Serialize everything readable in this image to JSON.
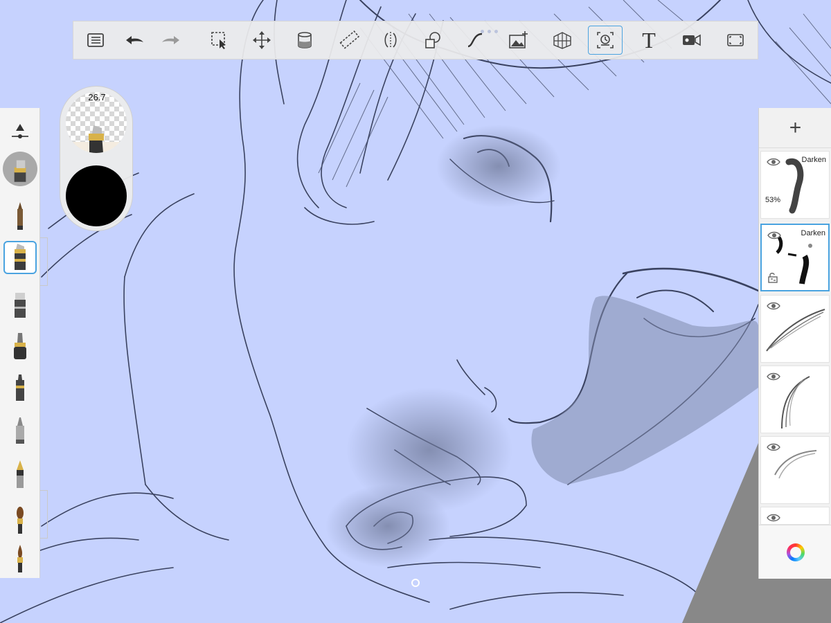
{
  "app": {
    "name": "Sketchbook canvas"
  },
  "toolbar": {
    "items": [
      {
        "icon": "menu-list-icon"
      },
      {
        "icon": "undo-icon"
      },
      {
        "icon": "redo-icon"
      },
      {
        "icon": "selection-icon"
      },
      {
        "icon": "transform-move-icon"
      },
      {
        "icon": "fill-bucket-icon"
      },
      {
        "icon": "ruler-icon"
      },
      {
        "icon": "symmetry-icon"
      },
      {
        "icon": "shapes-icon"
      },
      {
        "icon": "curve-icon"
      },
      {
        "icon": "add-image-icon"
      },
      {
        "icon": "perspective-grid-icon"
      },
      {
        "icon": "time-lapse-icon",
        "active": true
      },
      {
        "icon": "text-icon",
        "label": "T"
      },
      {
        "icon": "record-video-icon"
      },
      {
        "icon": "fullscreen-icon"
      }
    ]
  },
  "brush": {
    "size": "26.7",
    "color": "#000000"
  },
  "brush_palette": {
    "items": [
      "brush-properties-icon",
      "brush-library-icon",
      "pencil-icon",
      "marker-icon",
      "chisel-marker-icon",
      "felt-pen-icon",
      "ink-pen-icon",
      "ballpoint-icon",
      "fountain-pen-icon",
      "paintbrush-icon",
      "fine-brush-icon"
    ],
    "selected_index": 3
  },
  "layers": {
    "add_label": "+",
    "items": [
      {
        "blend": "Darken",
        "opacity": "53%",
        "selected": false
      },
      {
        "blend": "Darken",
        "opacity": "",
        "selected": true
      },
      {
        "blend": "",
        "opacity": "",
        "selected": false
      },
      {
        "blend": "",
        "opacity": "",
        "selected": false
      },
      {
        "blend": "",
        "opacity": "",
        "selected": false
      },
      {
        "blend": "",
        "opacity": "",
        "selected": false
      }
    ]
  },
  "colors": {
    "canvas_bg": "#c6d2fe",
    "accent": "#4aa3e0",
    "sketch": "#2c3550"
  }
}
